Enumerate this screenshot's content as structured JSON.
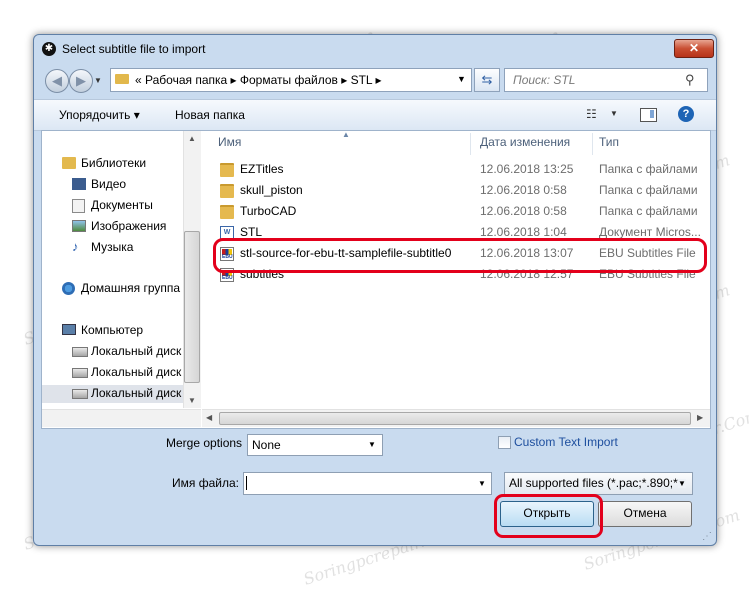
{
  "window": {
    "title": "Select subtitle file to import",
    "close_glyph": "✕"
  },
  "nav": {
    "back_glyph": "◀",
    "forward_glyph": "▶",
    "breadcrumb": "«  Рабочая папка  ▸  Форматы файлов  ▸  STL  ▸",
    "search_placeholder": "Поиск: STL"
  },
  "toolbar": {
    "organize_label": "Упорядочить ▾",
    "new_folder_label": "Новая папка"
  },
  "sidebar": {
    "items": [
      {
        "label": "Библиотеки",
        "icon": "library-icon"
      },
      {
        "label": "Видео",
        "icon": "video-icon"
      },
      {
        "label": "Документы",
        "icon": "documents-icon"
      },
      {
        "label": "Изображения",
        "icon": "images-icon"
      },
      {
        "label": "Музыка",
        "icon": "music-icon"
      },
      {
        "label": "Домашняя группа",
        "icon": "homegroup-icon"
      },
      {
        "label": "Компьютер",
        "icon": "computer-icon"
      },
      {
        "label": "Локальный диск",
        "icon": "drive-icon"
      },
      {
        "label": "Локальный диск",
        "icon": "drive-icon"
      },
      {
        "label": "Локальный диск",
        "icon": "drive-icon"
      }
    ]
  },
  "files": {
    "columns": {
      "name": "Имя",
      "date": "Дата изменения",
      "type": "Тип"
    },
    "rows": [
      {
        "name": "EZTitles",
        "date": "12.06.2018 13:25",
        "type": "Папка с файлами",
        "icon": "folder-icon"
      },
      {
        "name": "skull_piston",
        "date": "12.06.2018 0:58",
        "type": "Папка с файлами",
        "icon": "folder-icon"
      },
      {
        "name": "TurboCAD",
        "date": "12.06.2018 0:58",
        "type": "Папка с файлами",
        "icon": "folder-icon"
      },
      {
        "name": "STL",
        "date": "12.06.2018 1:04",
        "type": "Документ Micros...",
        "icon": "word-document-icon"
      },
      {
        "name": "stl-source-for-ebu-tt-samplefile-subtitle0",
        "date": "12.06.2018 13:07",
        "type": "EBU Subtitles File",
        "icon": "ebu-file-icon"
      },
      {
        "name": "subtitles",
        "date": "12.06.2018 12:57",
        "type": "EBU Subtitles File",
        "icon": "ebu-file-icon"
      }
    ]
  },
  "options": {
    "merge_label": "Merge options",
    "merge_value": "None",
    "custom_text_import_label": "Custom Text Import"
  },
  "filename": {
    "label": "Имя файла:",
    "value": ""
  },
  "filetype": {
    "value": "All supported files (*.pac;*.890;*"
  },
  "buttons": {
    "open_label": "Открыть",
    "cancel_label": "Отмена"
  },
  "watermark": "Soringpcrepair.Com",
  "colors": {
    "highlight": "#e3001b",
    "window_frame": "#c9dbef",
    "link": "#1d4e9e"
  }
}
